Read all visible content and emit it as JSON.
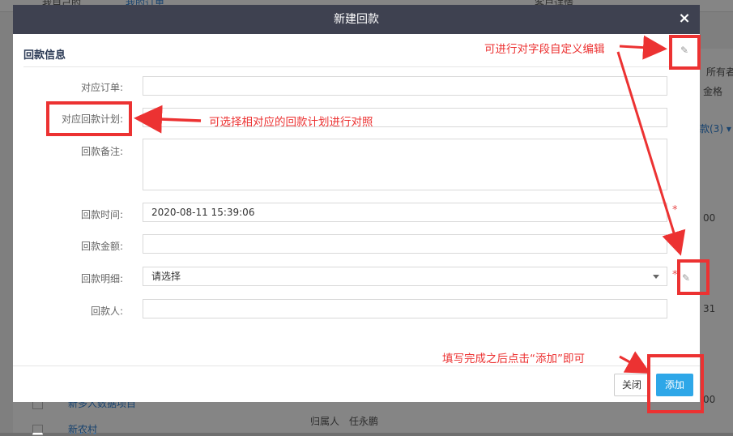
{
  "background": {
    "top_left_text": "我自己的",
    "top_link": "我的订单",
    "top_right_text": "客户详情",
    "right_col_1": "所有者",
    "right_col_2": "金格",
    "right_tab": "款(3) ▾",
    "right_value_1": "00",
    "right_value_2": "31",
    "right_value_3": "00",
    "bottom_link_1": "新多人数据项目",
    "bottom_link_2": "新农村",
    "bottom_owner_label": "归属人",
    "bottom_owner_value": "任永鹏"
  },
  "modal": {
    "title": "新建回款",
    "close_symbol": "×",
    "section_title": "回款信息",
    "fields": {
      "order": {
        "label": "对应订单:",
        "value": ""
      },
      "plan": {
        "label": "对应回款计划:",
        "value": ""
      },
      "remark": {
        "label": "回款备注:",
        "value": ""
      },
      "time": {
        "label": "回款时间:",
        "value": "2020-08-11 15:39:06"
      },
      "amount": {
        "label": "回款金额:",
        "value": ""
      },
      "detail": {
        "label": "回款明细:",
        "value": "请选择"
      },
      "payer": {
        "label": "回款人:",
        "value": ""
      }
    },
    "required_mark": "*",
    "buttons": {
      "close": "关闭",
      "add": "添加"
    }
  },
  "annotations": {
    "custom_field_note": "可进行对字段自定义编辑",
    "plan_note": "可选择相对应的回款计划进行对照",
    "submit_note": "填写完成之后点击“添加”即可"
  },
  "colors": {
    "annotation_red": "#ec3232",
    "header_bg": "#3e4150",
    "primary_button": "#2ea7e8"
  },
  "icons": [
    "close-icon",
    "edit-icon",
    "chevron-down-icon"
  ]
}
